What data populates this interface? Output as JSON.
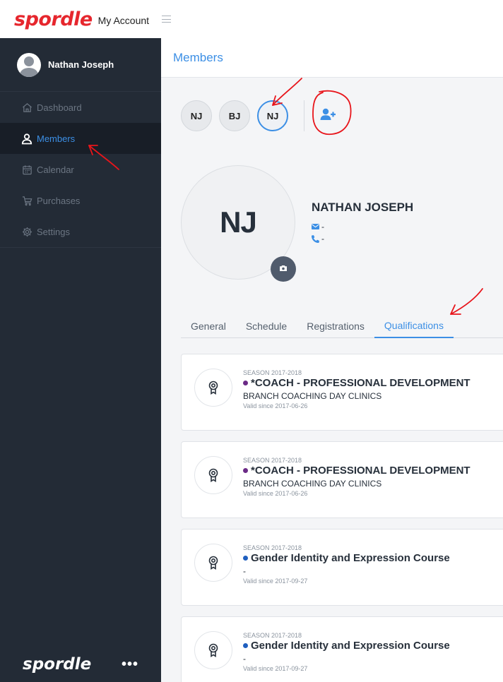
{
  "header": {
    "logo": "spordle",
    "title": "My Account"
  },
  "sidebar": {
    "user_name": "Nathan Joseph",
    "items": [
      {
        "label": "Dashboard",
        "icon": "home-icon",
        "active": false
      },
      {
        "label": "Members",
        "icon": "user-icon",
        "active": true
      },
      {
        "label": "Calendar",
        "icon": "calendar-icon",
        "active": false
      },
      {
        "label": "Purchases",
        "icon": "cart-icon",
        "active": false
      },
      {
        "label": "Settings",
        "icon": "gear-icon",
        "active": false
      }
    ],
    "footer_logo": "spordle",
    "more_label": "•••"
  },
  "page": {
    "title": "Members"
  },
  "members": [
    {
      "initials": "NJ",
      "active": false
    },
    {
      "initials": "BJ",
      "active": false
    },
    {
      "initials": "NJ",
      "active": true
    }
  ],
  "profile": {
    "initials": "NJ",
    "name": "NATHAN JOSEPH",
    "email": "-",
    "phone": "-"
  },
  "tabs": [
    {
      "label": "General",
      "active": false
    },
    {
      "label": "Schedule",
      "active": false
    },
    {
      "label": "Registrations",
      "active": false
    },
    {
      "label": "Qualifications",
      "active": true
    }
  ],
  "qualifications": [
    {
      "season": "SEASON 2017-2018",
      "title": "*COACH - PROFESSIONAL DEVELOPMENT",
      "dot_color": "#6b2a86",
      "subtitle": "BRANCH COACHING DAY CLINICS",
      "valid": "Valid since 2017-06-26"
    },
    {
      "season": "SEASON 2017-2018",
      "title": "*COACH - PROFESSIONAL DEVELOPMENT",
      "dot_color": "#6b2a86",
      "subtitle": "BRANCH COACHING DAY CLINICS",
      "valid": "Valid since 2017-06-26"
    },
    {
      "season": "SEASON 2017-2018",
      "title": "Gender Identity and Expression Course",
      "dot_color": "#1f5fbf",
      "subtitle": "-",
      "valid": "Valid since 2017-09-27"
    },
    {
      "season": "SEASON 2017-2018",
      "title": "Gender Identity and Expression Course",
      "dot_color": "#1f5fbf",
      "subtitle": "-",
      "valid": "Valid since 2017-09-27"
    }
  ],
  "colors": {
    "accent": "#3c8fe5",
    "sidebar_bg": "#232b36",
    "brand_red": "#e6262d",
    "annotation_red": "#e8151b"
  }
}
